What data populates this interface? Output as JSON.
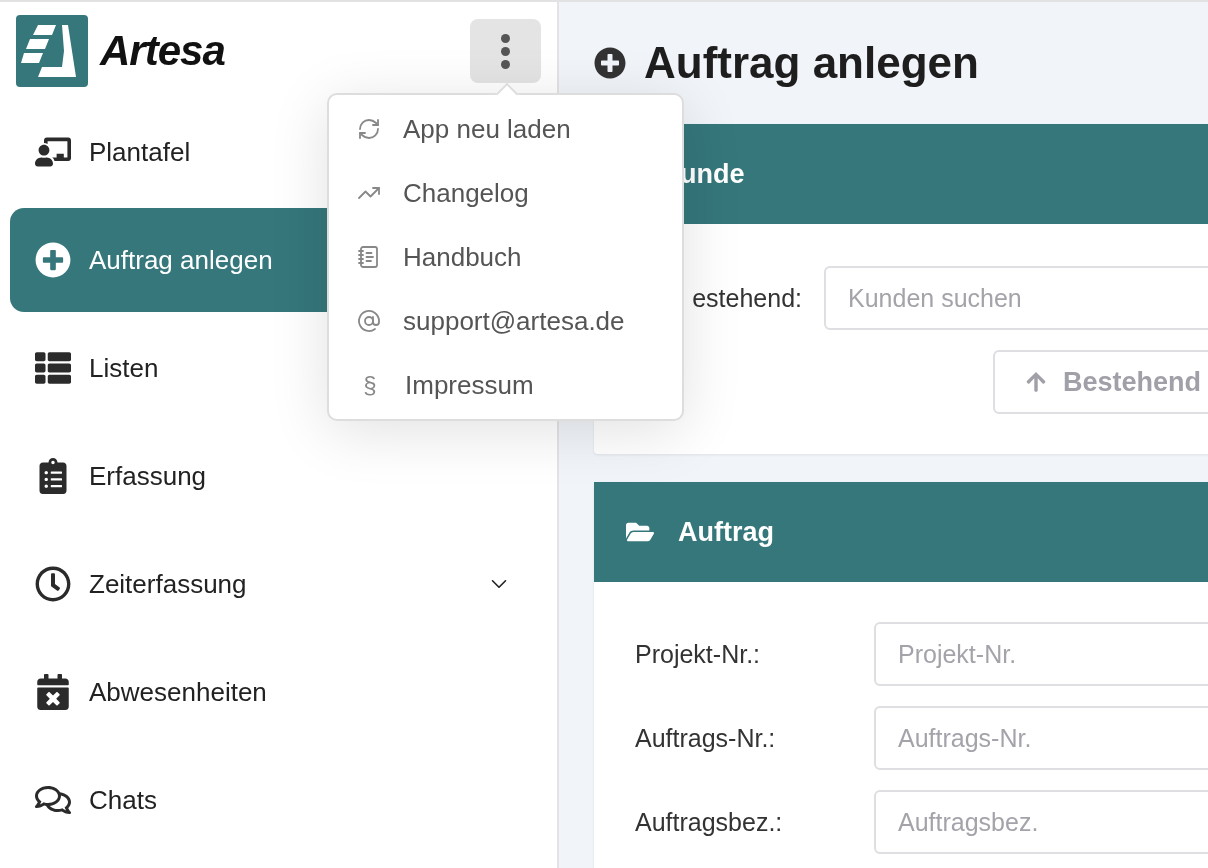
{
  "brand": {
    "name": "Artesa"
  },
  "menu_button": {
    "expanded": true
  },
  "menu": [
    {
      "label": "App neu laden"
    },
    {
      "label": "Changelog"
    },
    {
      "label": "Handbuch"
    },
    {
      "label": "support@artesa.de"
    },
    {
      "label": "Impressum",
      "symbol": "§"
    }
  ],
  "sidebar": {
    "items": [
      {
        "label": "Plantafel",
        "kind": "link",
        "selected": false
      },
      {
        "label": "Auftrag anlegen",
        "kind": "link",
        "selected": true
      },
      {
        "label": "Listen",
        "kind": "link",
        "selected": false
      },
      {
        "label": "Erfassung",
        "kind": "link",
        "selected": false
      },
      {
        "label": "Zeiterfassung",
        "kind": "group",
        "selected": false,
        "expanded": false
      },
      {
        "label": "Abwesenheiten",
        "kind": "link",
        "selected": false
      },
      {
        "label": "Chats",
        "kind": "link",
        "selected": false
      }
    ]
  },
  "page_title": "Auftrag anlegen",
  "customer_card": {
    "title": "unde",
    "label": "estehend:",
    "search": {
      "placeholder": "Kunden suchen"
    },
    "button": "Bestehend"
  },
  "order_card": {
    "title": "Auftrag",
    "fields": [
      {
        "label": "Projekt-Nr.:",
        "placeholder": "Projekt-Nr."
      },
      {
        "label": "Auftrags-Nr.:",
        "placeholder": "Auftrags-Nr."
      },
      {
        "label": "Auftragsbez.:",
        "placeholder": "Auftragsbez."
      }
    ]
  }
}
